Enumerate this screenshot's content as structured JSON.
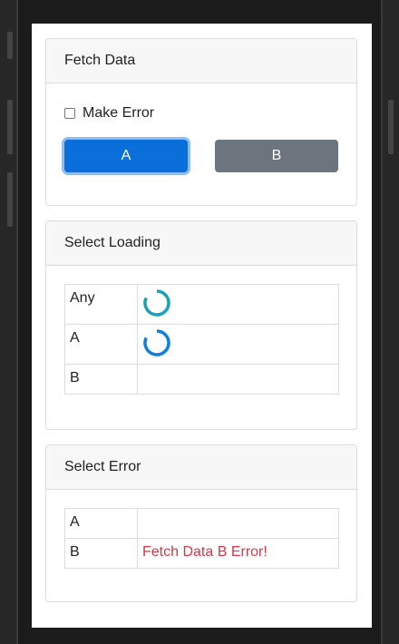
{
  "fetch_card": {
    "title": "Fetch Data",
    "checkbox_label": "Make Error",
    "checkbox_checked": false,
    "button_a_label": "A",
    "button_b_label": "B",
    "button_a_color": "#0a6edb",
    "button_b_color": "#6c757d"
  },
  "loading_card": {
    "title": "Select Loading",
    "rows": [
      {
        "key": "Any",
        "loading": true,
        "spinner_color": "#17a2b8"
      },
      {
        "key": "A",
        "loading": true,
        "spinner_color": "#0d7fe0"
      },
      {
        "key": "B",
        "loading": false
      }
    ]
  },
  "error_card": {
    "title": "Select Error",
    "rows": [
      {
        "key": "A",
        "value": ""
      },
      {
        "key": "B",
        "value": "Fetch Data B Error!"
      }
    ],
    "error_color": "#dc3545"
  }
}
